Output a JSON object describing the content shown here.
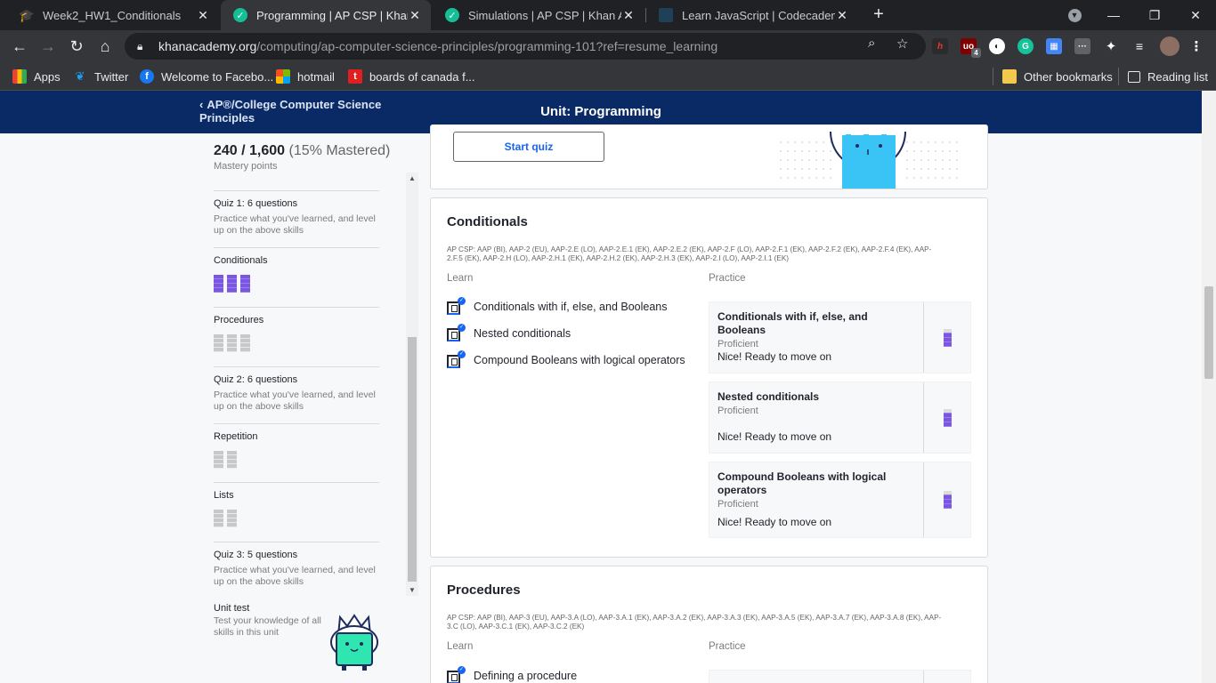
{
  "browser": {
    "tabs": [
      {
        "title": "Week2_HW1_Conditionals",
        "favicon": "graduation-cap-icon"
      },
      {
        "title": "Programming | AP CSP | Khan Ac",
        "favicon": "khan-academy-icon"
      },
      {
        "title": "Simulations | AP CSP | Khan Acad",
        "favicon": "khan-academy-icon"
      },
      {
        "title": "Learn JavaScript | Codecademy",
        "favicon": "codecademy-icon"
      }
    ],
    "url_host": "khanacademy.org",
    "url_path": "/computing/ap-computer-science-principles/programming-101?ref=resume_learning",
    "bookmarks": [
      {
        "label": "Apps",
        "icon": "apps-grid-icon"
      },
      {
        "label": "Twitter",
        "icon": "twitter-icon"
      },
      {
        "label": "Welcome to Facebo...",
        "icon": "facebook-icon"
      },
      {
        "label": "hotmail",
        "icon": "microsoft-icon"
      },
      {
        "label": "boards of canada f...",
        "icon": "tumblr-icon"
      }
    ],
    "other_bookmarks": "Other bookmarks",
    "reading_list": "Reading list",
    "ext_badge": "4"
  },
  "header": {
    "back_link": "AP®/College Computer Science Principles",
    "title": "Unit: Programming"
  },
  "sidebar": {
    "points": "240 / 1,600",
    "percent": "(15% Mastered)",
    "points_label": "Mastery points",
    "items": [
      {
        "title": "Quiz 1: 6 questions",
        "desc": "Practice what you've learned, and level up on the above skills"
      },
      {
        "title": "Conditionals"
      },
      {
        "title": "Procedures"
      },
      {
        "title": "Quiz 2: 6 questions",
        "desc": "Practice what you've learned, and level up on the above skills"
      },
      {
        "title": "Repetition"
      },
      {
        "title": "Lists"
      },
      {
        "title": "Quiz 3: 5 questions",
        "desc": "Practice what you've learned, and level up on the above skills"
      }
    ],
    "unit_test": {
      "title": "Unit test",
      "desc": "Test your knowledge of all skills in this unit"
    }
  },
  "main": {
    "start_quiz": "Start quiz",
    "conditionals": {
      "title": "Conditionals",
      "standards": "AP CSP: AAP (BI), AAP-2 (EU), AAP-2.E (LO), AAP-2.E.1 (EK), AAP-2.E.2 (EK), AAP-2.F (LO), AAP-2.F.1 (EK), AAP-2.F.2 (EK), AAP-2.F.4 (EK), AAP-2.F.5 (EK), AAP-2.H (LO), AAP-2.H.1 (EK), AAP-2.H.2 (EK), AAP-2.H.3 (EK), AAP-2.I (LO), AAP-2.I.1 (EK)",
      "learn_label": "Learn",
      "practice_label": "Practice",
      "learn": [
        "Conditionals with if, else, and Booleans",
        "Nested conditionals",
        "Compound Booleans with logical operators"
      ],
      "practice": [
        {
          "title": "Conditionals with if, else, and Booleans",
          "level": "Proficient",
          "message": "Nice! Ready to move on"
        },
        {
          "title": "Nested conditionals",
          "level": "Proficient",
          "message": "Nice! Ready to move on"
        },
        {
          "title": "Compound Booleans with logical operators",
          "level": "Proficient",
          "message": "Nice! Ready to move on"
        }
      ]
    },
    "procedures": {
      "title": "Procedures",
      "standards": "AP CSP: AAP (BI), AAP-3 (EU), AAP-3.A (LO), AAP-3.A.1 (EK), AAP-3.A.2 (EK), AAP-3.A.3 (EK), AAP-3.A.5 (EK), AAP-3.A.7 (EK), AAP-3.A.8 (EK), AAP-3.C (LO), AAP-3.C.1 (EK), AAP-3.C.2 (EK)",
      "learn_label": "Learn",
      "practice_label": "Practice",
      "learn": [
        "Defining a procedure"
      ]
    }
  },
  "colors": {
    "header_bg": "#0a2a66",
    "accent_blue": "#1865f2",
    "mastered_purple": "#7b57e0",
    "mascot_blue": "#3ac4f5",
    "mascot_green": "#2fe6b0"
  }
}
